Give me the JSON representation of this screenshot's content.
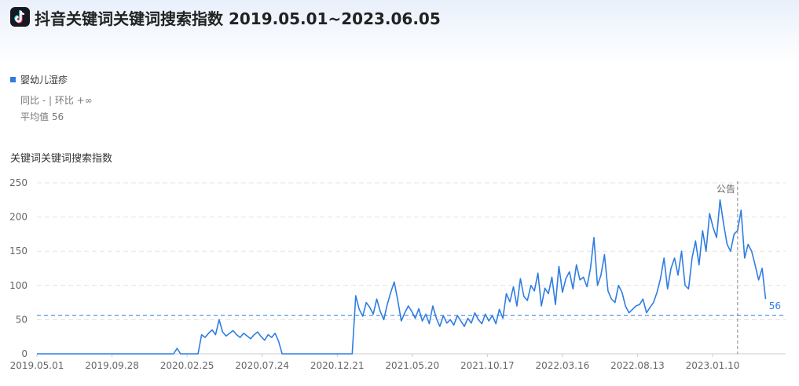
{
  "header": {
    "title": "抖音关键词关键词搜索指数 2019.05.01~2023.06.05",
    "logo_icon": "douyin-logo-icon"
  },
  "legend": {
    "series_name": "婴幼儿湿疹",
    "yoy_text": "同比 - | 环比 +∞",
    "avg_text": "平均值 56"
  },
  "colors": {
    "series": "#2f7de1",
    "grid": "#e3e3e3",
    "axis_text": "#666666"
  },
  "chart_data": {
    "type": "line",
    "ylabel": "关键词关键词搜索指数",
    "ylim": [
      0,
      250
    ],
    "yticks": [
      0,
      50,
      100,
      150,
      200,
      250
    ],
    "xlim": [
      "2019-05-01",
      "2023-06-05"
    ],
    "xtick_labels": [
      "2019.05.01",
      "2019.09.28",
      "2020.02.25",
      "2020.07.24",
      "2020.12.21",
      "2021.05.20",
      "2021.10.17",
      "2022.03.16",
      "2022.08.13",
      "2023.01.10"
    ],
    "xtick_dates": [
      "2019-05-01",
      "2019-09-28",
      "2020-02-25",
      "2020-07-24",
      "2020-12-21",
      "2021-05-20",
      "2021-10-17",
      "2022-03-16",
      "2022-08-13",
      "2023-01-10"
    ],
    "average": 56,
    "average_label": "56",
    "annotation": {
      "label": "公告",
      "date": "2023-03-01"
    },
    "series": [
      {
        "name": "婴幼儿湿疹",
        "interval_days": 7,
        "x_start": "2019-05-01",
        "values": [
          0,
          0,
          0,
          0,
          0,
          0,
          0,
          0,
          0,
          0,
          0,
          0,
          0,
          0,
          0,
          0,
          0,
          0,
          0,
          0,
          0,
          0,
          0,
          0,
          0,
          0,
          0,
          0,
          0,
          0,
          0,
          0,
          0,
          0,
          0,
          0,
          0,
          0,
          0,
          0,
          8,
          0,
          0,
          0,
          0,
          0,
          0,
          28,
          24,
          30,
          35,
          28,
          50,
          32,
          26,
          30,
          34,
          28,
          24,
          30,
          26,
          22,
          28,
          32,
          25,
          20,
          28,
          24,
          30,
          18,
          0,
          0,
          0,
          0,
          0,
          0,
          0,
          0,
          0,
          0,
          0,
          0,
          0,
          0,
          0,
          0,
          0,
          0,
          0,
          0,
          0,
          85,
          65,
          55,
          75,
          68,
          58,
          80,
          62,
          50,
          72,
          90,
          105,
          78,
          48,
          60,
          70,
          62,
          52,
          66,
          48,
          58,
          44,
          70,
          52,
          40,
          56,
          45,
          50,
          42,
          56,
          48,
          40,
          52,
          45,
          60,
          50,
          44,
          58,
          48,
          56,
          44,
          65,
          52,
          88,
          76,
          98,
          70,
          110,
          84,
          78,
          100,
          92,
          118,
          70,
          96,
          88,
          112,
          72,
          128,
          90,
          110,
          120,
          95,
          130,
          108,
          112,
          98,
          125,
          170,
          100,
          115,
          145,
          92,
          80,
          75,
          100,
          90,
          70,
          60,
          65,
          70,
          72,
          80,
          60,
          68,
          75,
          90,
          110,
          140,
          95,
          125,
          140,
          115,
          150,
          100,
          95,
          140,
          165,
          130,
          180,
          150,
          205,
          185,
          170,
          225,
          190,
          160,
          150,
          175,
          180,
          210,
          140,
          160,
          150,
          130,
          108,
          125,
          80
        ]
      }
    ]
  }
}
